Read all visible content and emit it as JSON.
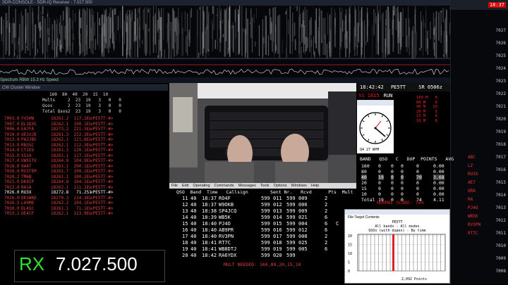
{
  "sdr": {
    "title": "SDR-CONSOLE - SDR-IQ Receiver - 7.027.500",
    "toolbar": "Spectrum   RBW 15.3 Hz   Speed"
  },
  "scale": {
    "header_value": "18:37",
    "freqs": [
      "7027",
      "7026",
      "7025",
      "7024",
      "7023",
      "7022",
      "7021",
      "7020",
      "7019",
      "7018",
      "7017",
      "7016",
      "7015",
      "7014",
      "7013",
      "7012",
      "7011",
      "7010",
      "7009",
      "7008"
    ],
    "calls": [
      "ABC",
      "LZ",
      "RU3X",
      "AE7",
      "ORA",
      "RA",
      "PJ4O",
      "WB5K",
      "RV3PN",
      "RT7C"
    ]
  },
  "bandmap": {
    "title": "CW Cluster Window",
    "stats_header": "160  80  40  20  15  10",
    "stats": [
      {
        "label": "Mults",
        "values": "2  23  19   3   0   0"
      },
      {
        "label": "Qsos",
        "values": "2  23  19   3   0   0"
      },
      {
        "label": "Total Qsos",
        "values": "2  23  19   3   0   0"
      }
    ],
    "spots": [
      {
        "freq": "7003.0",
        "call": "YV5HW",
        "info": "18261.2  117.1EL",
        "tag": "<PE5TT-#>",
        "color": "red"
      },
      {
        "freq": "7007.0",
        "call": "DL1DXS",
        "info": "18262.1  100.1EL",
        "tag": "<PE5TT-#>",
        "color": "red"
      },
      {
        "freq": "7006.0",
        "call": "EA7FA",
        "info": "18273.2  221.3EL",
        "tag": "<PE5TT-#>",
        "color": "red"
      },
      {
        "freq": "7010.0",
        "call": "OE3XJB",
        "info": "18261.3  222.3EL",
        "tag": "<PE5TT-#>",
        "color": "red"
      },
      {
        "freq": "7013.8",
        "call": "PA3JBS",
        "info": "18262.1  121.8EL",
        "tag": "<PE5TT-#>",
        "color": "red"
      },
      {
        "freq": "7013.9",
        "call": "RN3SC",
        "info": "18262.1  112.3EL",
        "tag": "<PE5TT-#>",
        "color": "red"
      },
      {
        "freq": "7014.0",
        "call": "CT1EO",
        "info": "18261.3  120.1EL",
        "tag": "<PE5TT-#>",
        "color": "red"
      },
      {
        "freq": "7015.0",
        "call": "S51A",
        "info": "18261.1  117.1EL",
        "tag": "<PE5TT-#>",
        "color": "red"
      },
      {
        "freq": "7017.0",
        "call": "UW9ITX",
        "info": "18264.0  104.9EL",
        "tag": "<PE5TT-#>",
        "color": "red"
      },
      {
        "freq": "7018.0",
        "call": "9A4T",
        "info": "18261.1  200.1EL",
        "tag": "<PE5TT-#>",
        "color": "red"
      },
      {
        "freq": "7020.0",
        "call": "RV3TEM",
        "info": "18261.7  100.1EL",
        "tag": "<PE5TT-#>",
        "color": "red"
      },
      {
        "freq": "7020.2",
        "call": "TM6B",
        "info": "18261.1  100.2EL",
        "tag": "<PE5TT-#>",
        "color": "red"
      },
      {
        "freq": "7021.0",
        "call": "DK9IP",
        "info": "18264.8  104.1EL",
        "tag": "<PE5TT-#>",
        "color": "red"
      },
      {
        "freq": "7022.8",
        "call": "RA3A",
        "info": "18262.1  111.1EL",
        "tag": "<PE5TT-#>",
        "color": "red"
      },
      {
        "freq": "7026.0",
        "call": "RU3X",
        "info": "18272.8   71.251",
        "tag": "<PE5TT-#>",
        "color": "white"
      },
      {
        "freq": "7026.0",
        "call": "OK3WKD",
        "info": "18270.3  214.3EL",
        "tag": "<PE5TT-#>",
        "color": "red"
      },
      {
        "freq": "7026.5",
        "call": "LA9MO",
        "info": "18262.2  104.1EL",
        "tag": "<PE5TT-#>",
        "color": "red"
      },
      {
        "freq": "7030.0",
        "call": "DL4SC",
        "info": "18261.1   71.1EL",
        "tag": "<PE5TT-#>",
        "color": "red"
      },
      {
        "freq": "7033.2",
        "call": "OE4CF",
        "info": "18262.1  123.9EL",
        "tag": "<PE5TT-#>",
        "color": "red"
      }
    ]
  },
  "rx": {
    "label": "RX",
    "frequency": "7.027.500"
  },
  "log": {
    "menu": [
      "File",
      "Edit",
      "Operating",
      "Commands",
      "Messages",
      "Tools",
      "Options",
      "Windows",
      "Help"
    ],
    "header": "QSO  Band  Time   Callsign        Sent Nr.   Rcvd      Pts  Mult",
    "rows": [
      {
        "qso": "11",
        "band": "40",
        "time": "18:37",
        "call": "RO4F",
        "sent": "599",
        "snr": "011",
        "rcvd": "599",
        "rnr": "009",
        "pts": "2",
        "mult": ""
      },
      {
        "qso": "12",
        "band": "40",
        "time": "18:37",
        "call": "W9OKB",
        "sent": "599",
        "snr": "012",
        "rcvd": "599",
        "rnr": "006",
        "pts": "2",
        "mult": ""
      },
      {
        "qso": "13",
        "band": "40",
        "time": "18:38",
        "call": "SP4JCQ",
        "sent": "599",
        "snr": "013",
        "rcvd": "599",
        "rnr": "009",
        "pts": "2",
        "mult": ""
      },
      {
        "qso": "14",
        "band": "40",
        "time": "18:39",
        "call": "WB5K",
        "sent": "599",
        "snr": "014",
        "rcvd": "599",
        "rnr": "021",
        "pts": "6",
        "mult": ""
      },
      {
        "qso": "15",
        "band": "40",
        "time": "18:40",
        "call": "PJ4O",
        "sent": "599",
        "snr": "015",
        "rcvd": "599",
        "rnr": "004",
        "pts": "6",
        "mult": "C"
      },
      {
        "qso": "16",
        "band": "40",
        "time": "18:40",
        "call": "AB9PR",
        "sent": "599",
        "snr": "016",
        "rcvd": "599",
        "rnr": "012",
        "pts": "6",
        "mult": ""
      },
      {
        "qso": "17",
        "band": "40",
        "time": "18:40",
        "call": "RV3PN",
        "sent": "599",
        "snr": "017",
        "rcvd": "599",
        "rnr": "008",
        "pts": "2",
        "mult": ""
      },
      {
        "qso": "18",
        "band": "40",
        "time": "18:41",
        "call": "RT7C",
        "sent": "599",
        "snr": "018",
        "rcvd": "599",
        "rnr": "025",
        "pts": "2",
        "mult": ""
      },
      {
        "qso": "19",
        "band": "40",
        "time": "18:41",
        "call": "WB8DTJ",
        "sent": "599",
        "snr": "019",
        "rcvd": "599",
        "rnr": "005",
        "pts": "6",
        "mult": ""
      },
      {
        "qso": "20",
        "band": "40",
        "time": "18:42",
        "call": "RA6YDX",
        "sent": "599",
        "snr": "020",
        "rcvd": "599",
        "rnr": "",
        "pts": "",
        "mult": ""
      }
    ],
    "mult_needed": "MULT NEEDED: 160,80,20,15,10"
  },
  "rate": {
    "time": "18:42:42",
    "call": "PE5TT",
    "sr": "SR 0506z",
    "ss": "SS 1815",
    "mode": "RUN",
    "lines": [
      "160 M   0",
      "80 M    0",
      "40 M   19",
      "20 M    3",
      "15 M    0",
      "10 M    0"
    ],
    "score_header": "BAND   QSO   C   DUP  POINTS   AVG",
    "score_rows": [
      {
        "band": "160",
        "qso": "0",
        "c": "0",
        "dup": "0",
        "points": "0",
        "avg": "0.00"
      },
      {
        "band": "80",
        "qso": "0",
        "c": "0",
        "dup": "0",
        "points": "0",
        "avg": "0.00"
      },
      {
        "band": "40",
        "qso": "19",
        "c": "0",
        "dup": "0",
        "points": "70",
        "avg": "3.68"
      },
      {
        "band": "20",
        "qso": "0",
        "c": "0",
        "dup": "0",
        "points": "0",
        "avg": "0.00"
      },
      {
        "band": "15",
        "qso": "0",
        "c": "0",
        "dup": "0",
        "points": "0",
        "avg": "0.00"
      },
      {
        "band": "10",
        "qso": "0",
        "c": "0",
        "dup": "0",
        "points": "0",
        "avg": "0.00"
      },
      {
        "band": "Total",
        "qso": "19",
        "c": "0",
        "dup": "0",
        "points": "74",
        "avg": "4.11"
      }
    ],
    "summary": "NORMAL SCORE: 784",
    "clock_rate": "Q4 27 WPM"
  },
  "graph": {
    "title": "PE5TT",
    "subtitle": "All bands - All modes",
    "subtitle2": "QSOs (with dupes) - By time",
    "tabs": [
      "File",
      "Target",
      "Contents"
    ],
    "yticks": [
      "20",
      "15",
      "10",
      "5",
      "0"
    ],
    "footer": "2,092 Points"
  },
  "colors": {
    "accent_red": "#e02020",
    "rx_green": "#2ee82e"
  }
}
